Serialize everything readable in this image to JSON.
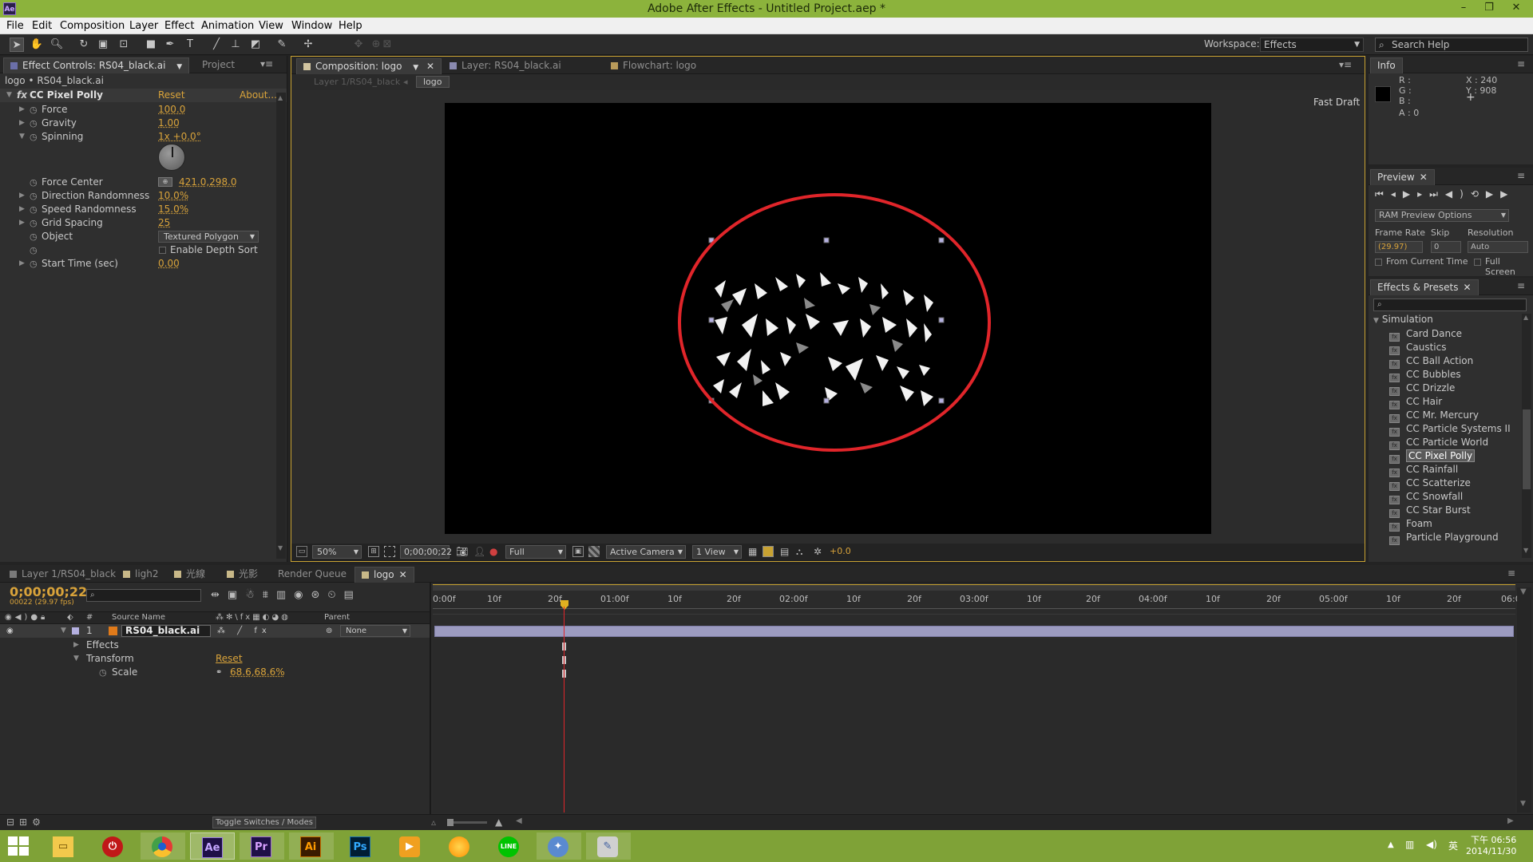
{
  "window": {
    "title": "Adobe After Effects - Untitled Project.aep *",
    "app_icon": "Ae",
    "minimize": "–",
    "maximize": "❐",
    "close": "✕"
  },
  "menu": [
    "File",
    "Edit",
    "Composition",
    "Layer",
    "Effect",
    "Animation",
    "View",
    "Window",
    "Help"
  ],
  "toolbar": {
    "workspace_label": "Workspace:",
    "workspace_value": "Effects",
    "search_placeholder": "Search Help"
  },
  "effect_controls": {
    "tab_label": "Effect Controls: RS04_black.ai",
    "project_tab": "Project",
    "breadcrumb": "logo • RS04_black.ai",
    "effect_name": "CC Pixel Polly",
    "reset": "Reset",
    "about": "About...",
    "params": [
      {
        "name": "Force",
        "value": "100.0"
      },
      {
        "name": "Gravity",
        "value": "1.00"
      },
      {
        "name": "Spinning",
        "value": "1x +0.0°"
      },
      {
        "name": "Force Center",
        "value": "421.0,298.0"
      },
      {
        "name": "Direction Randomness",
        "value": "10.0%"
      },
      {
        "name": "Speed Randomness",
        "value": "15.0%"
      },
      {
        "name": "Grid Spacing",
        "value": "25"
      },
      {
        "name": "Object",
        "value": "Textured Polygon"
      },
      {
        "name": "Enable Depth Sort",
        "value": ""
      },
      {
        "name": "Start Time (sec)",
        "value": "0.00"
      }
    ]
  },
  "composition": {
    "tabs": [
      "Composition: logo",
      "Layer: RS04_black.ai",
      "Flowchart: logo"
    ],
    "breadcrumb_inactive": "Layer 1/RS04_black",
    "breadcrumb_active": "logo",
    "fast_draft": "Fast Draft",
    "bottom": {
      "zoom": "50%",
      "timecode": "0;00;00;22",
      "resolution": "Full",
      "camera": "Active Camera",
      "views": "1 View",
      "exposure": "+0.0"
    }
  },
  "info": {
    "tab": "Info",
    "r": "R :",
    "g": "G :",
    "b": "B :",
    "a": "A : 0",
    "x": "X : 240",
    "y": "Y : 908"
  },
  "preview": {
    "tab": "Preview",
    "ram_options": "RAM Preview Options",
    "frame_rate_label": "Frame Rate",
    "skip_label": "Skip",
    "resolution_label": "Resolution",
    "frame_rate_value": "(29.97)",
    "skip_value": "0",
    "resolution_value": "Auto",
    "from_current": "From Current Time",
    "full_screen": "Full Screen"
  },
  "effects_presets": {
    "tab": "Effects & Presets",
    "category": "Simulation",
    "items": [
      "Card Dance",
      "Caustics",
      "CC Ball Action",
      "CC Bubbles",
      "CC Drizzle",
      "CC Hair",
      "CC Mr. Mercury",
      "CC Particle Systems II",
      "CC Particle World",
      "CC Pixel Polly",
      "CC Rainfall",
      "CC Scatterize",
      "CC Snowfall",
      "CC Star Burst",
      "Foam",
      "Particle Playground"
    ],
    "selected_index": 9
  },
  "timeline": {
    "tabs": [
      "Layer 1/RS04_black",
      "ligh2",
      "光線",
      "光影",
      "Render Queue",
      "logo"
    ],
    "active_tab_index": 5,
    "timecode": "0;00;00;22",
    "timecode_sub": "00022 (29.97 fps)",
    "col_source": "Source Name",
    "col_parent": "Parent",
    "col_num": "#",
    "layer": {
      "num": "1",
      "name": "RS04_black.ai",
      "parent": "None"
    },
    "rows": [
      {
        "name": "Effects"
      },
      {
        "name": "Transform",
        "value": "Reset"
      },
      {
        "name": "Scale",
        "value": "68.6,68.6%"
      }
    ],
    "ruler": [
      "0:00f",
      "10f",
      "20f",
      "01:00f",
      "10f",
      "20f",
      "02:00f",
      "10f",
      "20f",
      "03:00f",
      "10f",
      "20f",
      "04:00f",
      "10f",
      "20f",
      "05:00f",
      "10f",
      "20f",
      "06:0"
    ],
    "toggle": "Toggle Switches / Modes"
  },
  "taskbar": {
    "apps": [
      "file-explorer",
      "power",
      "chrome",
      "Ae",
      "Pr",
      "Ai",
      "Ps",
      "media",
      "weather",
      "LINE",
      "app-a",
      "app-b"
    ],
    "ime": "英",
    "clock_time": "下午 06:56",
    "clock_date": "2014/11/30"
  },
  "colors": {
    "title_green": "#8cb33c",
    "accent_orange": "#d9a33a",
    "annotation_red": "#e0252a",
    "layer_bar": "#9c9bc0"
  }
}
